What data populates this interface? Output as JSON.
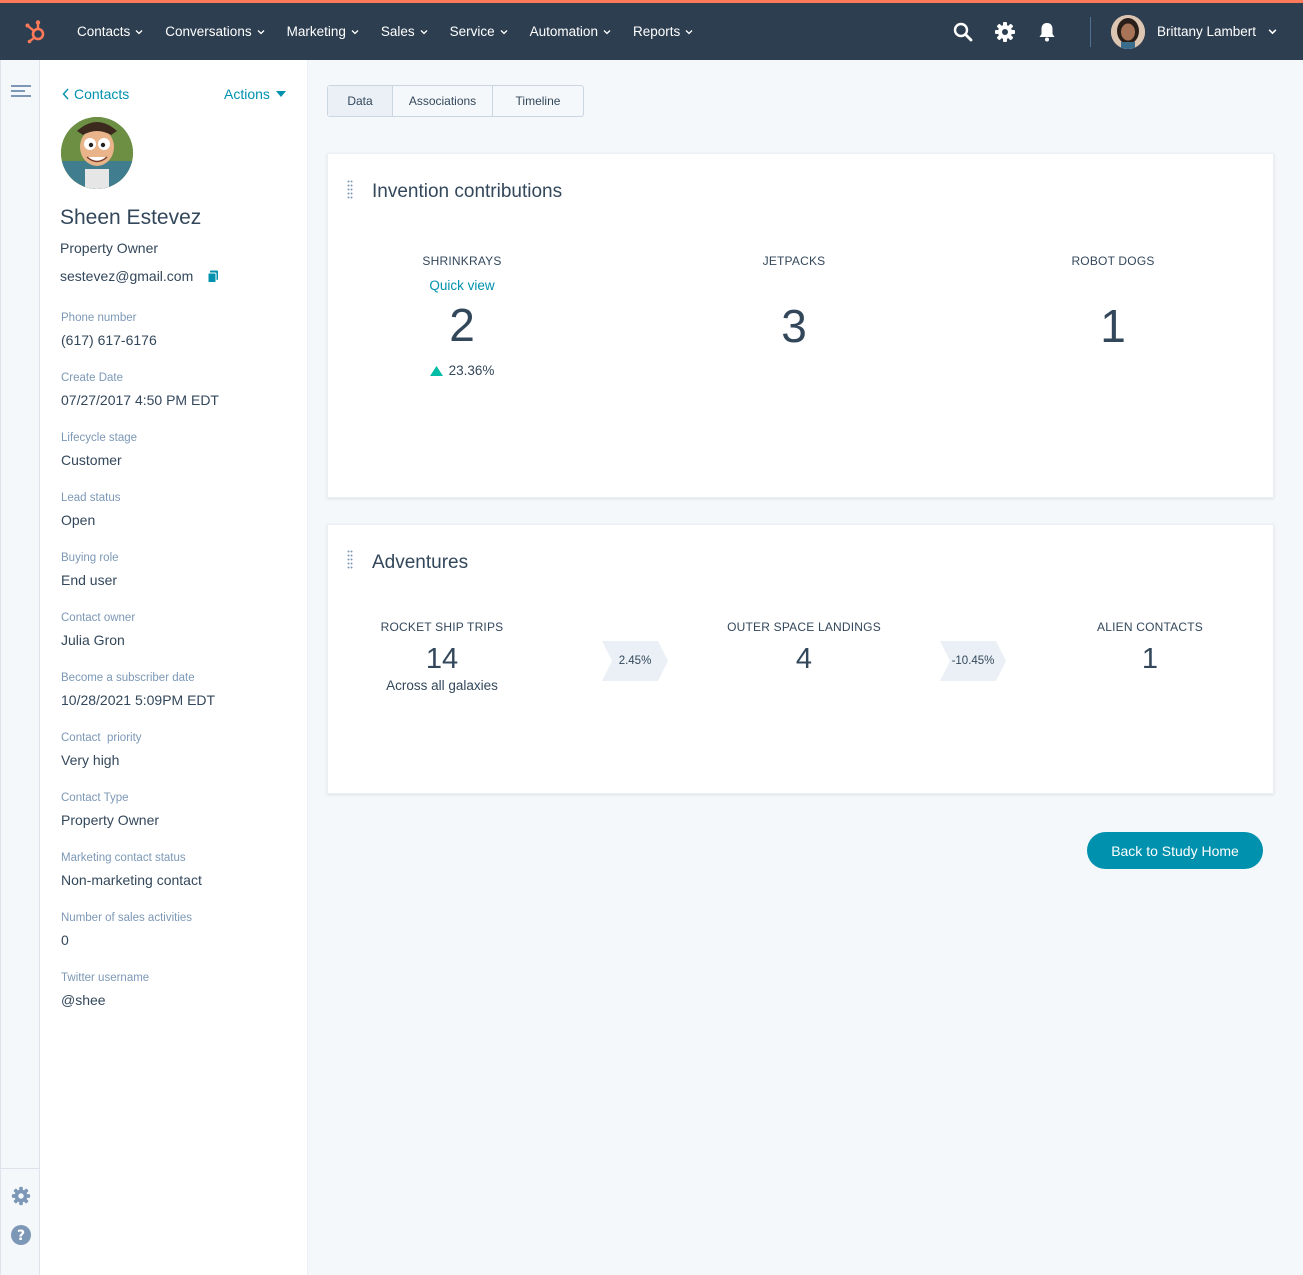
{
  "nav": {
    "items": [
      {
        "label": "Contacts"
      },
      {
        "label": "Conversations"
      },
      {
        "label": "Marketing"
      },
      {
        "label": "Sales"
      },
      {
        "label": "Service"
      },
      {
        "label": "Automation"
      },
      {
        "label": "Reports"
      }
    ],
    "user_name": "Brittany Lambert",
    "colors": {
      "bar": "#2d3e50",
      "accent": "#ff7a59"
    }
  },
  "sidebar": {
    "back_label": "Contacts",
    "actions_label": "Actions",
    "contact": {
      "name": "Sheen Estevez",
      "title": "Property Owner",
      "email": "sestevez@gmail.com"
    },
    "properties": [
      {
        "label": "Phone number",
        "value": "(617) 617-6176"
      },
      {
        "label": "Create Date",
        "value": "07/27/2017 4:50 PM EDT"
      },
      {
        "label": "Lifecycle stage",
        "value": "Customer"
      },
      {
        "label": "Lead status",
        "value": "Open"
      },
      {
        "label": "Buying role",
        "value": "End user"
      },
      {
        "label": "Contact owner",
        "value": "Julia Gron"
      },
      {
        "label": "Become a subscriber date",
        "value": "10/28/2021 5:09PM EDT"
      },
      {
        "label": "Contact  priority",
        "value": "Very high"
      },
      {
        "label": "Contact Type",
        "value": "Property Owner"
      },
      {
        "label": "Marketing contact status",
        "value": "Non-marketing contact"
      },
      {
        "label": "Number of sales activities",
        "value": "0"
      },
      {
        "label": "Twitter username",
        "value": "@shee"
      }
    ]
  },
  "tabs": [
    {
      "label": "Data",
      "active": true
    },
    {
      "label": "Associations",
      "active": false
    },
    {
      "label": "Timeline",
      "active": false
    }
  ],
  "inventions": {
    "title": "Invention contributions",
    "stats": [
      {
        "label": "SHRINKRAYS",
        "link": "Quick view",
        "value": "2",
        "delta": "23.36%"
      },
      {
        "label": "JETPACKS",
        "value": "3"
      },
      {
        "label": "ROBOT DOGS",
        "value": "1"
      }
    ]
  },
  "adventures": {
    "title": "Adventures",
    "stats": [
      {
        "label": "ROCKET SHIP TRIPS",
        "value": "14",
        "sub": "Across all galaxies"
      },
      {
        "label": "OUTER SPACE LANDINGS",
        "value": "4"
      },
      {
        "label": "ALIEN CONTACTS",
        "value": "1"
      }
    ],
    "conversions": [
      "2.45%",
      "-10.45%"
    ]
  },
  "cta": {
    "label": "Back to Study Home",
    "color": "#0091ae"
  },
  "icons": {
    "logo": "hubspot-sprocket-icon",
    "search": "search-icon",
    "settings": "gear-icon",
    "notifications": "bell-icon",
    "rail_menu": "menu-icon",
    "rail_settings": "gear-icon",
    "rail_help": "help-icon",
    "up_arrow": "triangle-up-icon"
  }
}
